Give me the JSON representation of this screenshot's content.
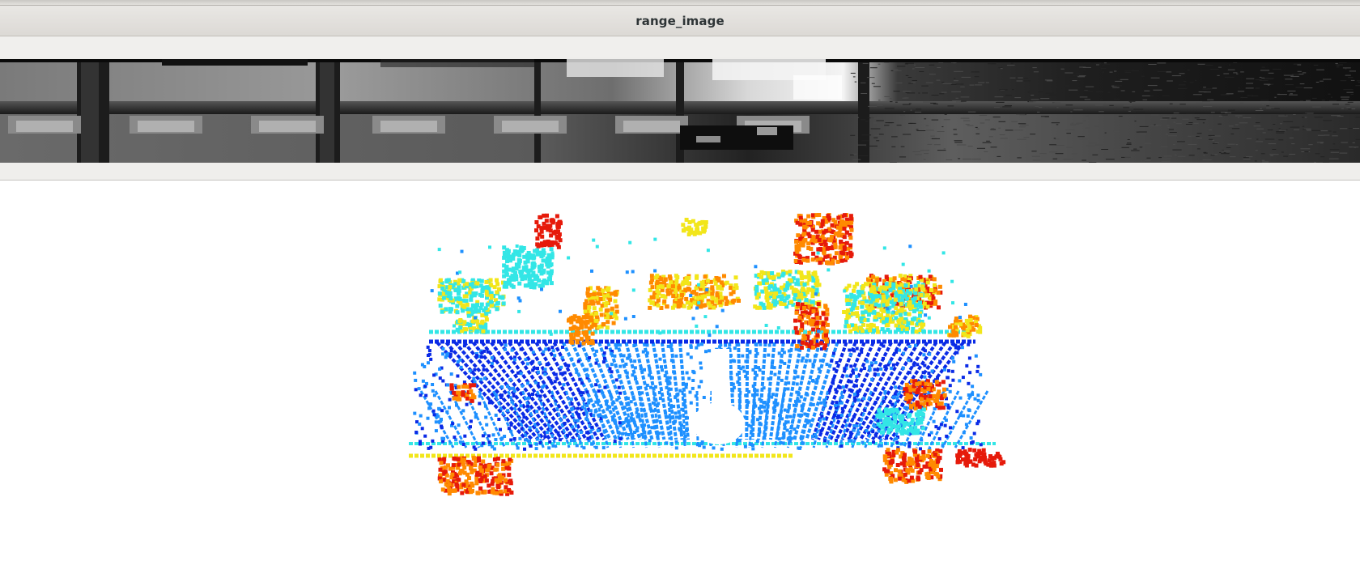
{
  "window": {
    "title": "range_image"
  },
  "range_image_panel": {
    "icon": "range-image-depth-view",
    "colormap": "grayscale"
  },
  "point_cloud_viewer": {
    "icon": "lidar-point-cloud",
    "colormap": "jet",
    "background": "#ffffff"
  },
  "colors": {
    "near": "#0a2ae6",
    "mid_near": "#1e90ff",
    "mid": "#33e6e6",
    "mid_far": "#f2e61a",
    "far": "#ff8a00",
    "farthest": "#e61a0a"
  }
}
